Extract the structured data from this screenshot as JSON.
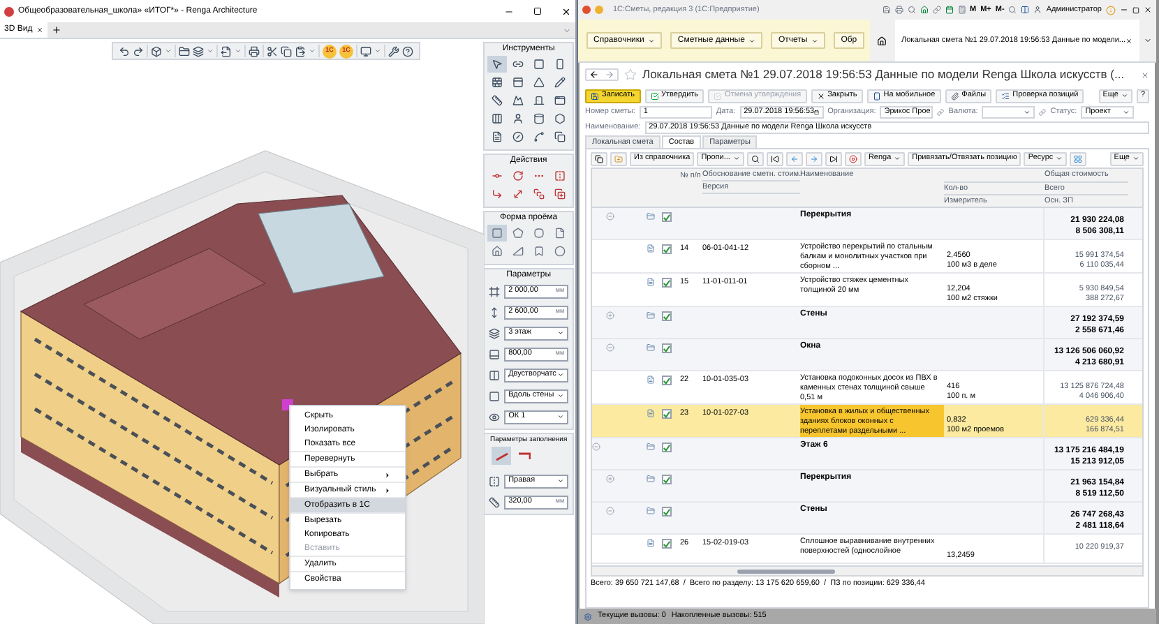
{
  "left_window": {
    "title": "Общеобразовательная_школа» «ИТОГ*» - Renga Architecture",
    "tabs": [
      {
        "label": "3D Вид",
        "selected": true
      }
    ],
    "toolbar_badges": [
      "1С",
      "1С"
    ],
    "tools_panel": {
      "title": "Инструменты",
      "tools": [
        {
          "selected": true
        },
        {
          "selected": false
        },
        {
          "selected": false
        },
        {
          "selected": false
        },
        {
          "selected": false
        },
        {
          "selected": false
        },
        {
          "selected": false
        },
        {
          "selected": false
        },
        {
          "selected": false
        },
        {
          "selected": false
        },
        {
          "selected": false
        },
        {
          "selected": false
        },
        {
          "selected": false
        },
        {
          "selected": false
        },
        {
          "selected": false
        },
        {
          "selected": false
        },
        {
          "selected": false
        },
        {
          "selected": false
        },
        {
          "selected": false
        },
        {
          "selected": false
        }
      ]
    },
    "actions_panel": {
      "title": "Действия"
    },
    "profile_panel": {
      "title": "Форма проёма",
      "shapes": [
        {
          "selected": true
        },
        {
          "selected": false
        },
        {
          "selected": false
        },
        {
          "selected": false
        },
        {
          "selected": false
        },
        {
          "selected": false
        },
        {
          "selected": false
        },
        {
          "selected": false
        }
      ]
    },
    "parameters_panel": {
      "title": "Параметры",
      "fields": [
        {
          "kind": "number",
          "value": "2 000,00",
          "unit": "мм"
        },
        {
          "kind": "number",
          "value": "2 600,00",
          "unit": "мм"
        },
        {
          "kind": "select",
          "value": "3 этаж"
        },
        {
          "kind": "number",
          "value": "800,00",
          "unit": "мм"
        },
        {
          "kind": "select",
          "value": "Двустворчатс"
        },
        {
          "kind": "select",
          "value": "Вдоль стены"
        },
        {
          "kind": "select",
          "value": "ОК 1"
        }
      ]
    },
    "fill_panel": {
      "title": "Параметры заполнения",
      "sashes": [
        {
          "selected": true
        },
        {
          "selected": false
        }
      ],
      "fields": [
        {
          "kind": "select",
          "value": "Правая"
        },
        {
          "kind": "number",
          "value": "320,00",
          "unit": "мм"
        }
      ]
    },
    "context_menu": {
      "groups": [
        [
          {
            "label": "Скрыть",
            "submenu": false,
            "highlighted": false,
            "disabled": false
          },
          {
            "label": "Изолировать",
            "submenu": false,
            "highlighted": false,
            "disabled": false
          },
          {
            "label": "Показать все",
            "submenu": false,
            "highlighted": false,
            "disabled": false
          }
        ],
        [
          {
            "label": "Перевернуть",
            "submenu": false,
            "highlighted": false,
            "disabled": false
          }
        ],
        [
          {
            "label": "Выбрать",
            "submenu": true,
            "highlighted": false,
            "disabled": false
          }
        ],
        [
          {
            "label": "Визуальный стиль",
            "submenu": true,
            "highlighted": false,
            "disabled": false
          }
        ],
        [
          {
            "label": "Отобразить в 1С",
            "submenu": false,
            "highlighted": true,
            "disabled": false
          }
        ],
        [
          {
            "label": "Вырезать",
            "submenu": false,
            "highlighted": false,
            "disabled": false
          },
          {
            "label": "Копировать",
            "submenu": false,
            "highlighted": false,
            "disabled": false
          },
          {
            "label": "Вставить",
            "submenu": false,
            "highlighted": false,
            "disabled": true
          }
        ],
        [
          {
            "label": "Удалить",
            "submenu": false,
            "highlighted": false,
            "disabled": false
          }
        ],
        [
          {
            "label": "Свойства",
            "submenu": false,
            "highlighted": false,
            "disabled": false
          }
        ]
      ]
    }
  },
  "right_window": {
    "title": "1С:Сметы, редакция 3  (1С:Предприятие)",
    "memory_buttons": [
      "M",
      "M+",
      "M-"
    ],
    "user": "Администратор",
    "nav": [
      {
        "label": "Справочники",
        "dropdown": true
      },
      {
        "label": "Сметные данные",
        "dropdown": true
      },
      {
        "label": "Отчеты",
        "dropdown": true
      },
      {
        "label": "Обр",
        "dropdown": false
      }
    ],
    "doc_tab": "Локальная смета №1 29.07.2018 19:56:53 Данные по модели...",
    "form": {
      "title": "Локальная смета №1 29.07.2018 19:56:53 Данные по модели Renga Школа искусств (...",
      "buttons": [
        {
          "label": "Записать",
          "kind": "primary",
          "disabled": false
        },
        {
          "label": "Утвердить",
          "kind": "approve",
          "disabled": false
        },
        {
          "label": "Отмена утверждения",
          "kind": "cancel",
          "disabled": true
        },
        {
          "label": "Закрыть",
          "kind": "close",
          "disabled": false
        },
        {
          "label": "На мобильное",
          "kind": "mobile",
          "disabled": false
        },
        {
          "label": "Файлы",
          "kind": "files",
          "disabled": false
        },
        {
          "label": "Проверка позиций",
          "kind": "check",
          "disabled": false
        }
      ],
      "more_button": "Еще",
      "help_button": "?",
      "fields": [
        {
          "label": "Номер сметы:",
          "value": "1",
          "kind": "text"
        },
        {
          "label": "Дата:",
          "value": "29.07.2018 19:56:53",
          "kind": "date"
        },
        {
          "label": "Организация:",
          "value": "Эрикос Прое",
          "kind": "link"
        },
        {
          "label": "Валюта:",
          "kind": "link"
        },
        {
          "label": "Статус:",
          "value": "Проект",
          "kind": "select"
        }
      ],
      "name_field": {
        "label": "Наименование:",
        "value": "29.07.2018 19:56:53 Данные по модели Renga Школа искусств"
      },
      "tabs": [
        {
          "label": "Локальная смета",
          "selected": false
        },
        {
          "label": "Состав",
          "selected": true
        },
        {
          "label": "Параметры",
          "selected": false
        }
      ],
      "table_toolbar": [
        {
          "label": "Из справочника",
          "dropdown": false
        },
        {
          "label": "Пропи...",
          "dropdown": true
        },
        {
          "label": "Renga",
          "dropdown": true
        },
        {
          "label": "Привязать/Отвязать позицию",
          "dropdown": false
        },
        {
          "label": "Ресурс",
          "dropdown": true
        },
        {
          "label": "Еще",
          "dropdown": true
        }
      ],
      "header": {
        "number": "№ п/п",
        "code": "Обоснование сметн. стоим.",
        "version": "Версия",
        "name": "Наименование",
        "quantity": "Кол-во",
        "unit": "Измеритель",
        "cost": "Общая стоимость",
        "total": "Всего",
        "salary": "Осн. ЗП"
      },
      "rows": [
        {
          "kind": "parent_out_of_view",
          "children": [
            {
              "kind": "group",
              "name": "Перекрытия",
              "checked": true,
              "expanded": true,
              "selected": false,
              "total": "21 930 224,08",
              "salary": "8 506 308,11",
              "children": [
                {
                  "kind": "item",
                  "number": "14",
                  "code": "06-01-041-12",
                  "name": "Устройство перекрытий по стальным балкам и монолитных участков при сборном ...",
                  "quantity": "2,4560",
                  "unit": "100 м3 в деле",
                  "total": "15 991 374,54",
                  "salary": "6 110 035,44",
                  "checked": true,
                  "selected": false
                },
                {
                  "kind": "item",
                  "number": "15",
                  "code": "11-01-011-01",
                  "name": "Устройство стяжек цементных толщиной 20 мм",
                  "quantity": "12,204",
                  "unit": "100 м2 стяжки",
                  "total": "5 930 849,54",
                  "salary": "388 272,67",
                  "checked": true,
                  "selected": false
                }
              ]
            },
            {
              "kind": "group",
              "name": "Стены",
              "checked": true,
              "expanded": false,
              "selected": false,
              "total": "27 192 374,59",
              "salary": "2 558 671,46"
            },
            {
              "kind": "group",
              "name": "Окна",
              "checked": true,
              "expanded": true,
              "selected": false,
              "total": "13 126 506 060,92",
              "salary": "4 213 680,91",
              "children": [
                {
                  "kind": "item",
                  "number": "22",
                  "code": "10-01-035-03",
                  "name": "Установка подоконных досок из ПВХ в каменных стенах толщиной свыше 0,51 м",
                  "quantity": "416",
                  "unit": "100 п. м",
                  "total": "13 125 876 724,48",
                  "salary": "4 046 906,40",
                  "checked": true,
                  "selected": false
                },
                {
                  "kind": "item",
                  "number": "23",
                  "code": "10-01-027-03",
                  "name": "Установка в жилых и общественных зданиях блоков оконных с переплетами раздельными ...",
                  "quantity": "0,832",
                  "unit": "100 м2 проемов",
                  "total": "629 336,44",
                  "salary": "166 874,51",
                  "checked": true,
                  "selected": true
                }
              ]
            }
          ]
        },
        {
          "kind": "group",
          "name": "Этаж 6",
          "checked": true,
          "expanded": true,
          "selected": false,
          "total": "13 175 216 484,19",
          "salary": "15 213 912,05",
          "children": [
            {
              "kind": "group",
              "name": "Перекрытия",
              "checked": true,
              "expanded": false,
              "selected": false,
              "total": "21 963 154,84",
              "salary": "8 519 112,50"
            },
            {
              "kind": "group",
              "name": "Стены",
              "checked": true,
              "expanded": true,
              "selected": false,
              "total": "26 747 268,43",
              "salary": "2 481 118,64",
              "children": [
                {
                  "kind": "item",
                  "number": "26",
                  "code": "15-02-019-03",
                  "name": "Сплошное выравнивание внутренних поверхностей (однослойное",
                  "quantity": "13,2459",
                  "total": "10 220 919,37",
                  "checked": true,
                  "selected": false
                }
              ]
            }
          ]
        }
      ],
      "totals": "Всего: 39 650 721 147,68  /  Всего по разделу: 13 175 620 659,60  /  ПЗ по позиции: 629 336,44"
    },
    "status": [
      "Текущие вызовы: 0",
      "Накопленные вызовы: 515"
    ]
  }
}
